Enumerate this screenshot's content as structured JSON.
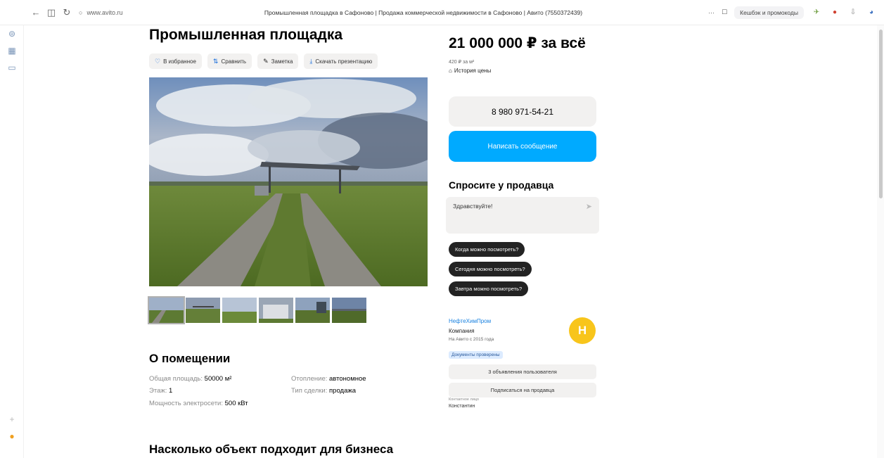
{
  "browser": {
    "url": "www.avito.ru",
    "tab_title": "Промышленная площадка в Сафоново | Продажа коммерческой недвижимости в Сафоново | Авито (7550372439)",
    "cashback_label": "Кешбэк и промокоды"
  },
  "listing": {
    "title": "Промышленная площадка",
    "actions": [
      "В избранное",
      "Сравнить",
      "Заметка",
      "Скачать презентацию"
    ],
    "price": "21 000 000 ₽ за всё",
    "price_per_m2": "420 ₽ за м²",
    "price_history": "История цены",
    "phone": "8 980 971-54-21",
    "write_button": "Написать сообщение"
  },
  "ask": {
    "title": "Спросите у продавца",
    "message": "Здравствуйте!",
    "chips": [
      "Когда можно посмотреть?",
      "Сегодня можно посмотреть?",
      "Завтра можно посмотреть?"
    ]
  },
  "seller": {
    "name": "НефтеХимПром",
    "type": "Компания",
    "since": "На Авито с 2015 года",
    "verified": "Документы проверены",
    "avatar_letter": "Н",
    "ads_button": "3 объявления пользователя",
    "subscribe_button": "Подписаться на продавца",
    "contact_label": "Контактное лицо",
    "contact_name": "Константин"
  },
  "about": {
    "title": "О помещении",
    "params": [
      {
        "label": "Общая площадь: ",
        "value": "50000 м²"
      },
      {
        "label": "Отопление: ",
        "value": "автономное"
      },
      {
        "label": "Этаж: ",
        "value": "1"
      },
      {
        "label": "Тип сделки: ",
        "value": "продажа"
      },
      {
        "label": "Мощность электросети: ",
        "value": "500 кВт"
      }
    ]
  },
  "business": {
    "title": "Насколько объект подходит для бизнеса"
  },
  "colors": {
    "accent_blue": "#00aaff",
    "avatar_yellow": "#f8c51b",
    "chip_dark": "#232323"
  },
  "icons": {
    "favorite": "heart-icon",
    "compare": "compare-icon",
    "note": "note-icon",
    "download": "download-icon",
    "history": "house-icon"
  }
}
